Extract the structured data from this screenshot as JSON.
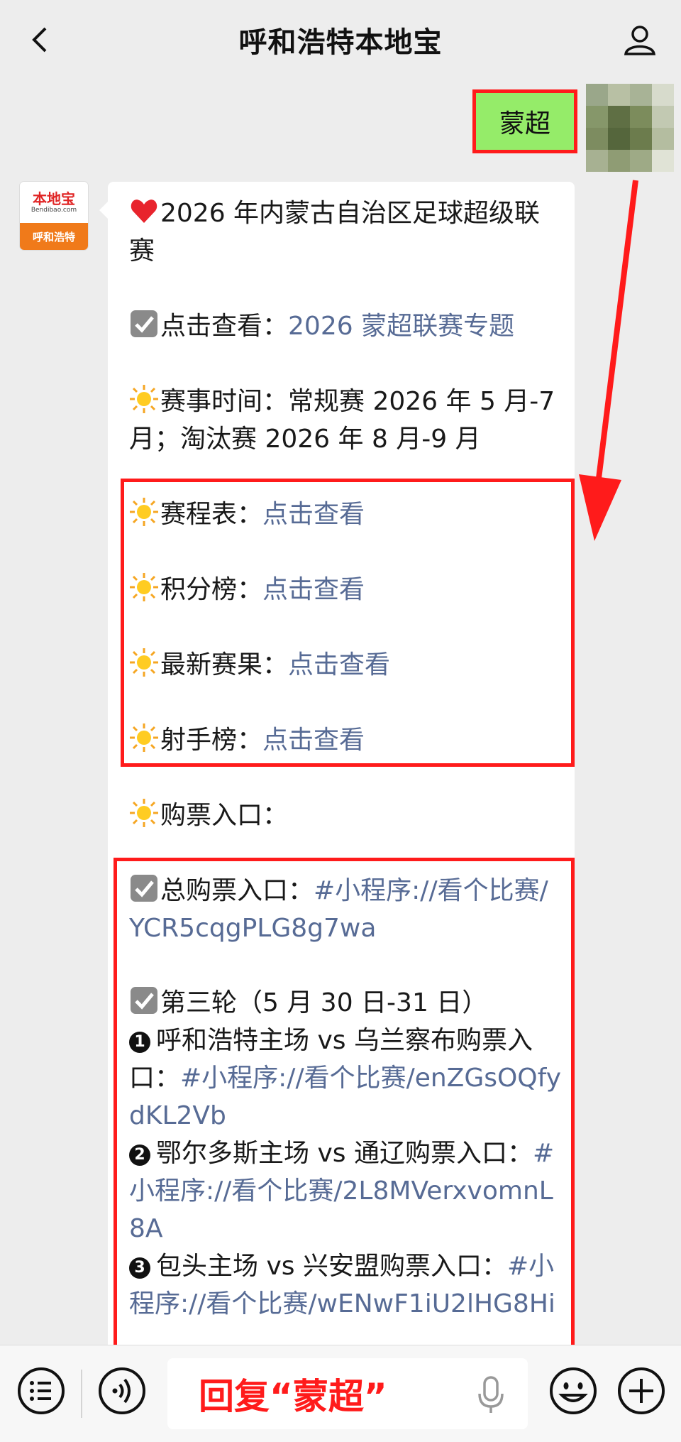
{
  "nav": {
    "title": "呼和浩特本地宝"
  },
  "outgoing": {
    "text": "蒙超"
  },
  "incoming_avatar": {
    "logo_cn": "本地宝",
    "logo_en": "Bendibao.com",
    "city": "呼和浩特"
  },
  "message": {
    "title": "2026 年内蒙古自治区足球超级联赛",
    "topic_label": "点击查看：",
    "topic_link": "2026 蒙超联赛专题",
    "time_label": "赛事时间：",
    "time_value": "常规赛 2026 年 5 月-7 月；淘汰赛 2026 年 8 月-9 月",
    "schedule": {
      "label": "赛程表：",
      "link": "点击查看"
    },
    "standings": {
      "label": "积分榜：",
      "link": "点击查看"
    },
    "results": {
      "label": "最新赛果：",
      "link": "点击查看"
    },
    "scorers": {
      "label": "射手榜：",
      "link": "点击查看"
    },
    "ticket_label": "购票入口：",
    "total_ticket_label": "总购票入口：",
    "total_ticket_link": "#小程序://看个比赛/YCR5cqgPLG8g7wa",
    "round_label": "第三轮（5 月 30 日-31 日）",
    "match1": {
      "num": "1",
      "text": "呼和浩特主场 vs 乌兰察布购票入口：",
      "link": "#小程序://看个比赛/enZGsOQfydKL2Vb"
    },
    "match2": {
      "num": "2",
      "text": "鄂尔多斯主场 vs 通辽购票入口：",
      "link": "#小程序://看个比赛/2L8MVerxvomnL8A"
    },
    "match3": {
      "num": "3",
      "text": "包头主场 vs 兴安盟购票入口：",
      "link": "#小程序://看个比赛/wENwF1iU2lHG8Hi"
    }
  },
  "input": {
    "text": "回复“蒙超”"
  },
  "icons": [
    "back-icon",
    "user-icon",
    "heart-icon",
    "checkbox-icon",
    "sun-icon",
    "list-icon",
    "voice-icon",
    "mic-icon",
    "emoji-icon",
    "plus-icon"
  ],
  "colors": {
    "link": "#576b95",
    "outgoing_bubble": "#95ec69",
    "highlight": "#ff1b1b",
    "background": "#ededed"
  }
}
